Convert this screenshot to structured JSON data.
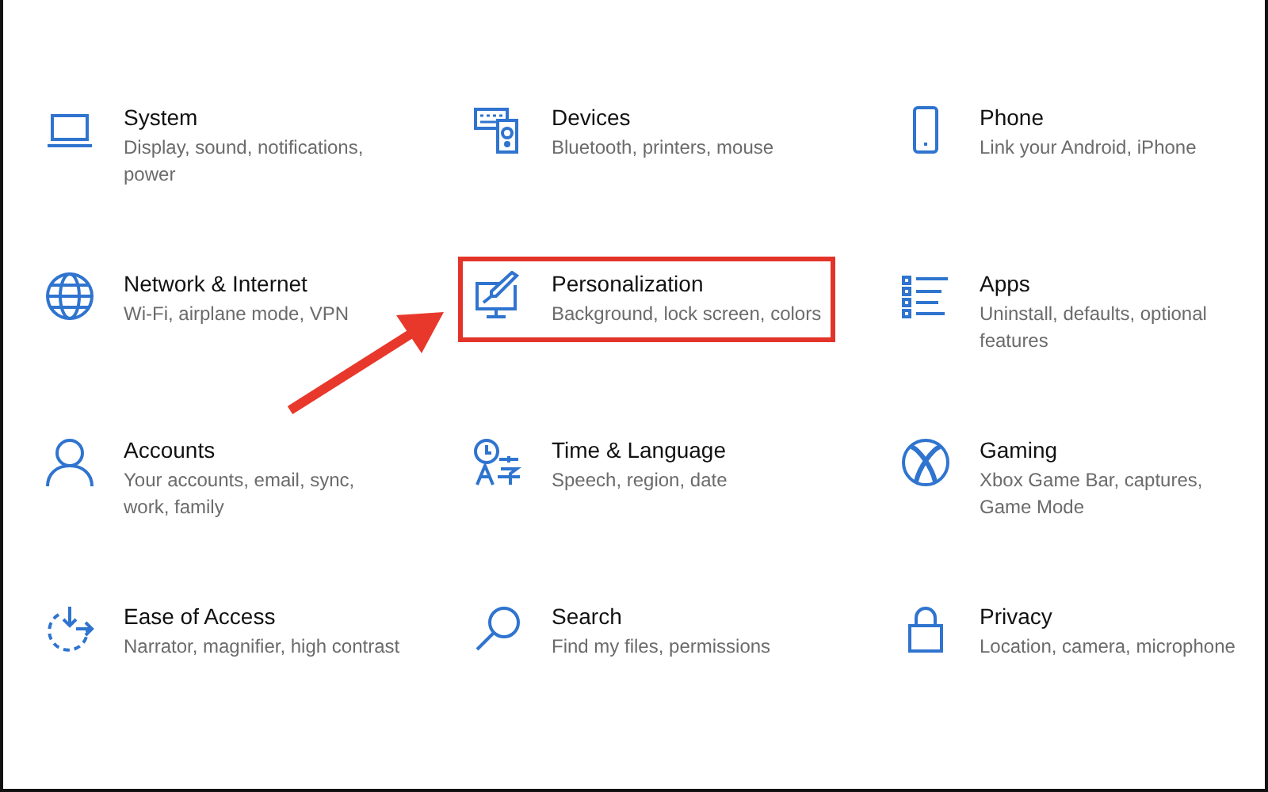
{
  "items": [
    {
      "title": "System",
      "description": "Display, sound, notifications, power",
      "highlighted": false
    },
    {
      "title": "Devices",
      "description": "Bluetooth, printers, mouse",
      "highlighted": false
    },
    {
      "title": "Phone",
      "description": "Link your Android, iPhone",
      "highlighted": false
    },
    {
      "title": "Network & Internet",
      "description": "Wi-Fi, airplane mode, VPN",
      "highlighted": false
    },
    {
      "title": "Personalization",
      "description": "Background, lock screen, colors",
      "highlighted": true
    },
    {
      "title": "Apps",
      "description": "Uninstall, defaults, optional features",
      "highlighted": false
    },
    {
      "title": "Accounts",
      "description": "Your accounts, email, sync, work, family",
      "highlighted": false
    },
    {
      "title": "Time & Language",
      "description": "Speech, region, date",
      "highlighted": false
    },
    {
      "title": "Gaming",
      "description": "Xbox Game Bar, captures, Game Mode",
      "highlighted": false
    },
    {
      "title": "Ease of Access",
      "description": "Narrator, magnifier, high contrast",
      "highlighted": false
    },
    {
      "title": "Search",
      "description": "Find my files, permissions",
      "highlighted": false
    },
    {
      "title": "Privacy",
      "description": "Location, camera, microphone",
      "highlighted": false
    }
  ]
}
